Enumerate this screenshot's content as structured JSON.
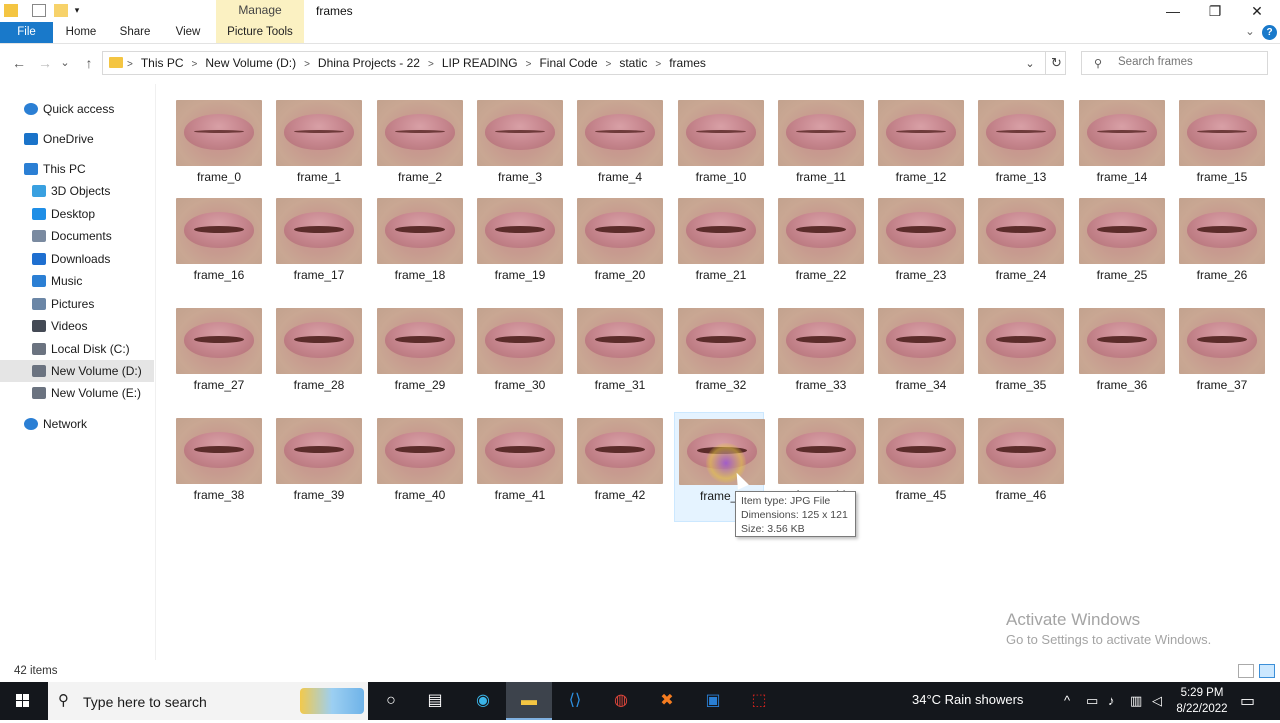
{
  "window": {
    "title": "frames",
    "context_group": "Manage",
    "minimize_glyph": "—",
    "restore_glyph": "❐",
    "close_glyph": "✕"
  },
  "ribbon": {
    "tabs": [
      "File",
      "Home",
      "Share",
      "View",
      "Picture Tools"
    ],
    "expand_glyph": "⌄",
    "help_glyph": "?"
  },
  "navigation": {
    "back_glyph": "←",
    "forward_glyph": "→",
    "recent_glyph": "⌄",
    "up_glyph": "↑",
    "breadcrumbs": [
      "This PC",
      "New Volume (D:)",
      "Dhina Projects - 22",
      "LIP READING",
      "Final Code",
      "static",
      "frames"
    ],
    "separator": ">",
    "dropdown_glyph": "⌄",
    "refresh_glyph": "↻"
  },
  "search": {
    "placeholder": "Search frames",
    "icon": "search-icon"
  },
  "sidebar": {
    "items": [
      {
        "label": "Quick access",
        "icon": "star-icon",
        "color": "#2b7fd4"
      },
      {
        "label": "OneDrive",
        "icon": "cloud-icon",
        "color": "#1a73c9"
      },
      {
        "label": "This PC",
        "icon": "computer-icon",
        "color": "#2b7fd4"
      },
      {
        "label": "3D Objects",
        "icon": "cube-icon",
        "color": "#39a0e0"
      },
      {
        "label": "Desktop",
        "icon": "desktop-icon",
        "color": "#1f8ee6"
      },
      {
        "label": "Documents",
        "icon": "document-icon",
        "color": "#7a8aa0"
      },
      {
        "label": "Downloads",
        "icon": "download-icon",
        "color": "#1f6fd0"
      },
      {
        "label": "Music",
        "icon": "music-icon",
        "color": "#2b7fd4"
      },
      {
        "label": "Pictures",
        "icon": "pictures-icon",
        "color": "#6b86a6"
      },
      {
        "label": "Videos",
        "icon": "video-icon",
        "color": "#444a55"
      },
      {
        "label": "Local Disk (C:)",
        "icon": "drive-icon",
        "color": "#6b7380"
      },
      {
        "label": "New Volume (D:)",
        "icon": "drive-icon",
        "color": "#6b7380",
        "selected": true
      },
      {
        "label": "New Volume (E:)",
        "icon": "drive-icon",
        "color": "#6b7380"
      },
      {
        "label": "Network",
        "icon": "network-icon",
        "color": "#2b7fd4"
      }
    ]
  },
  "files": [
    "frame_0",
    "frame_1",
    "frame_2",
    "frame_3",
    "frame_4",
    "frame_10",
    "frame_11",
    "frame_12",
    "frame_13",
    "frame_14",
    "frame_15",
    "frame_16",
    "frame_17",
    "frame_18",
    "frame_19",
    "frame_20",
    "frame_21",
    "frame_22",
    "frame_23",
    "frame_24",
    "frame_25",
    "frame_26",
    "frame_27",
    "frame_28",
    "frame_29",
    "frame_30",
    "frame_31",
    "frame_32",
    "frame_33",
    "frame_34",
    "frame_35",
    "frame_36",
    "frame_37",
    "frame_38",
    "frame_39",
    "frame_40",
    "frame_41",
    "frame_42",
    "frame_4",
    "frame_44",
    "frame_45",
    "frame_46"
  ],
  "selected_file_index": 38,
  "tooltip": {
    "line1": "Item type: JPG File",
    "line2": "Dimensions: 125 x 121",
    "line3": "Size: 3.56 KB"
  },
  "watermark": {
    "title": "Activate Windows",
    "subtitle": "Go to Settings to activate Windows."
  },
  "status": {
    "item_count": "42 items"
  },
  "taskbar": {
    "search_text": "Type here to search",
    "weather": "34°C  Rain showers",
    "time": "5:29 PM",
    "date": "8/22/2022",
    "tray_up_glyph": "^",
    "apps": [
      "task-view-icon",
      "edge-icon",
      "file-explorer-icon",
      "vscode-icon",
      "chrome-icon",
      "xampp-icon",
      "photos-icon",
      "acrobat-icon"
    ]
  }
}
